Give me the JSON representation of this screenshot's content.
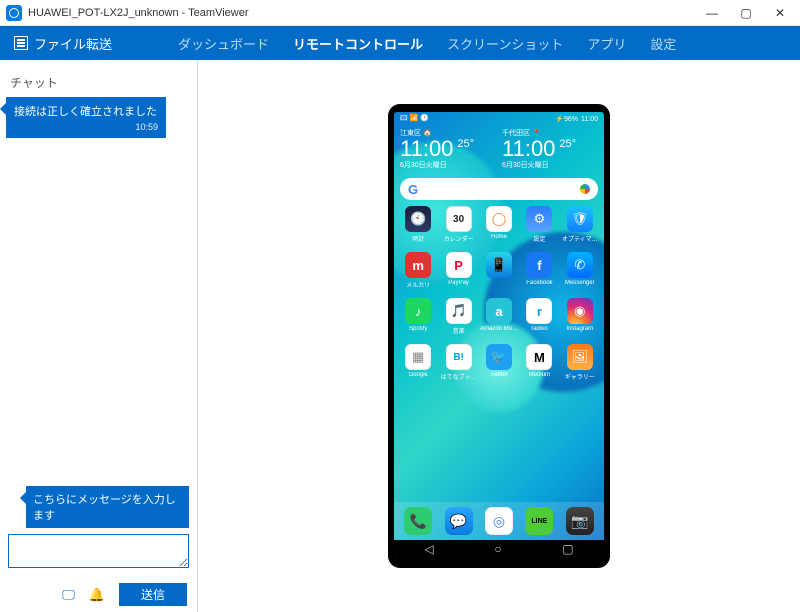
{
  "window": {
    "title": "HUAWEI_POT-LX2J_unknown - TeamViewer"
  },
  "header": {
    "file_transfer": "ファイル転送",
    "nav": {
      "dashboard": "ダッシュボード",
      "remote": "リモートコントロール",
      "screenshot": "スクリーンショット",
      "apps": "アプリ",
      "settings": "設定"
    }
  },
  "chat": {
    "label": "チャット",
    "message": "接続は正しく確立されました",
    "message_time": "10:59",
    "placeholder_bubble": "こちらにメッセージを入力します",
    "send": "送信"
  },
  "phone": {
    "statusbar": {
      "left": "🖾 📶 🕒",
      "battery": "⚡96%",
      "time": "11:00"
    },
    "clock1": {
      "city": "江東区 🏠",
      "time": "11:00",
      "date": "6月30日火曜日",
      "temp": "25°"
    },
    "clock2": {
      "city": "千代田区 📍",
      "time": "11:00",
      "date": "6月30日火曜日",
      "temp": "25°"
    },
    "apps": [
      {
        "label": "時計",
        "bg": "linear-gradient(#1a1e3c,#303a66)",
        "glyph": "🕙"
      },
      {
        "label": "カレンダー",
        "bg": "#fff",
        "glyph": "30",
        "style": "color:#222;font-weight:bold;font-size:10px;border:1px solid #ddd"
      },
      {
        "label": "Home",
        "bg": "#fff",
        "glyph": "◯",
        "style": "color:#f08a2c;border:1px solid #eee"
      },
      {
        "label": "設定",
        "bg": "linear-gradient(#2b7cff,#5aa2ff)",
        "glyph": "⚙"
      },
      {
        "label": "オプティマ…",
        "bg": "linear-gradient(#19c2ff,#1480ff)",
        "glyph": "🛡"
      },
      {
        "label": "メルカリ",
        "bg": "#e43131",
        "glyph": "m",
        "style": "font-weight:bold"
      },
      {
        "label": "PayPay",
        "bg": "#fff",
        "glyph": "P",
        "style": "color:#ff0033;font-weight:bold;border:1px solid #eee"
      },
      {
        "label": "",
        "bg": "linear-gradient(#26d6e9,#0a7be1)",
        "glyph": "📱"
      },
      {
        "label": "Facebook",
        "bg": "#1877f2",
        "glyph": "f",
        "style": "font-weight:bold"
      },
      {
        "label": "Messenger",
        "bg": "linear-gradient(#00b2ff,#006aff)",
        "glyph": "✆"
      },
      {
        "label": "Spotify",
        "bg": "#1ed760",
        "glyph": "♪"
      },
      {
        "label": "音楽",
        "bg": "#fff",
        "glyph": "🎵",
        "style": "border:1px solid #eee"
      },
      {
        "label": "Amazon Mu…",
        "bg": "#26c2d6",
        "glyph": "a",
        "style": "font-weight:bold"
      },
      {
        "label": "radiko",
        "bg": "#fff",
        "glyph": "r",
        "style": "color:#00a7e1;font-weight:bold;border:1px solid #eee"
      },
      {
        "label": "Instagram",
        "bg": "radial-gradient(circle at 30% 110%,#feda77,#f58529 30%,#dd2a7b 60%,#8134af 90%)",
        "glyph": "◉"
      },
      {
        "label": "Google",
        "bg": "#fff",
        "glyph": "▦",
        "style": "color:#888;border:1px solid #eee"
      },
      {
        "label": "はてなブッ…",
        "bg": "#fff",
        "glyph": "B!",
        "style": "color:#00a4de;font-weight:bold;font-size:10px;border:1px solid #eee"
      },
      {
        "label": "Twitter",
        "bg": "#1da1f2",
        "glyph": "🐦"
      },
      {
        "label": "Medium",
        "bg": "#fff",
        "glyph": "M",
        "style": "color:#000;font-weight:bold;border:1px solid #eee"
      },
      {
        "label": "ギャラリー",
        "bg": "linear-gradient(#ff7a18,#ffb14a)",
        "glyph": "🖼"
      }
    ],
    "dock": [
      {
        "name": "phone",
        "bg": "#2ecc71",
        "glyph": "📞"
      },
      {
        "name": "messages",
        "bg": "linear-gradient(#2aa5ff,#0a7be1)",
        "glyph": "💬"
      },
      {
        "name": "chrome",
        "bg": "#fff",
        "glyph": "◎",
        "style": "color:#4285F4;border:1px solid #eee"
      },
      {
        "name": "line",
        "bg": "#4ecb35",
        "glyph": "LINE",
        "style": "font-size:7px;font-weight:bold"
      },
      {
        "name": "camera",
        "bg": "linear-gradient(#444,#222)",
        "glyph": "📷"
      }
    ]
  }
}
